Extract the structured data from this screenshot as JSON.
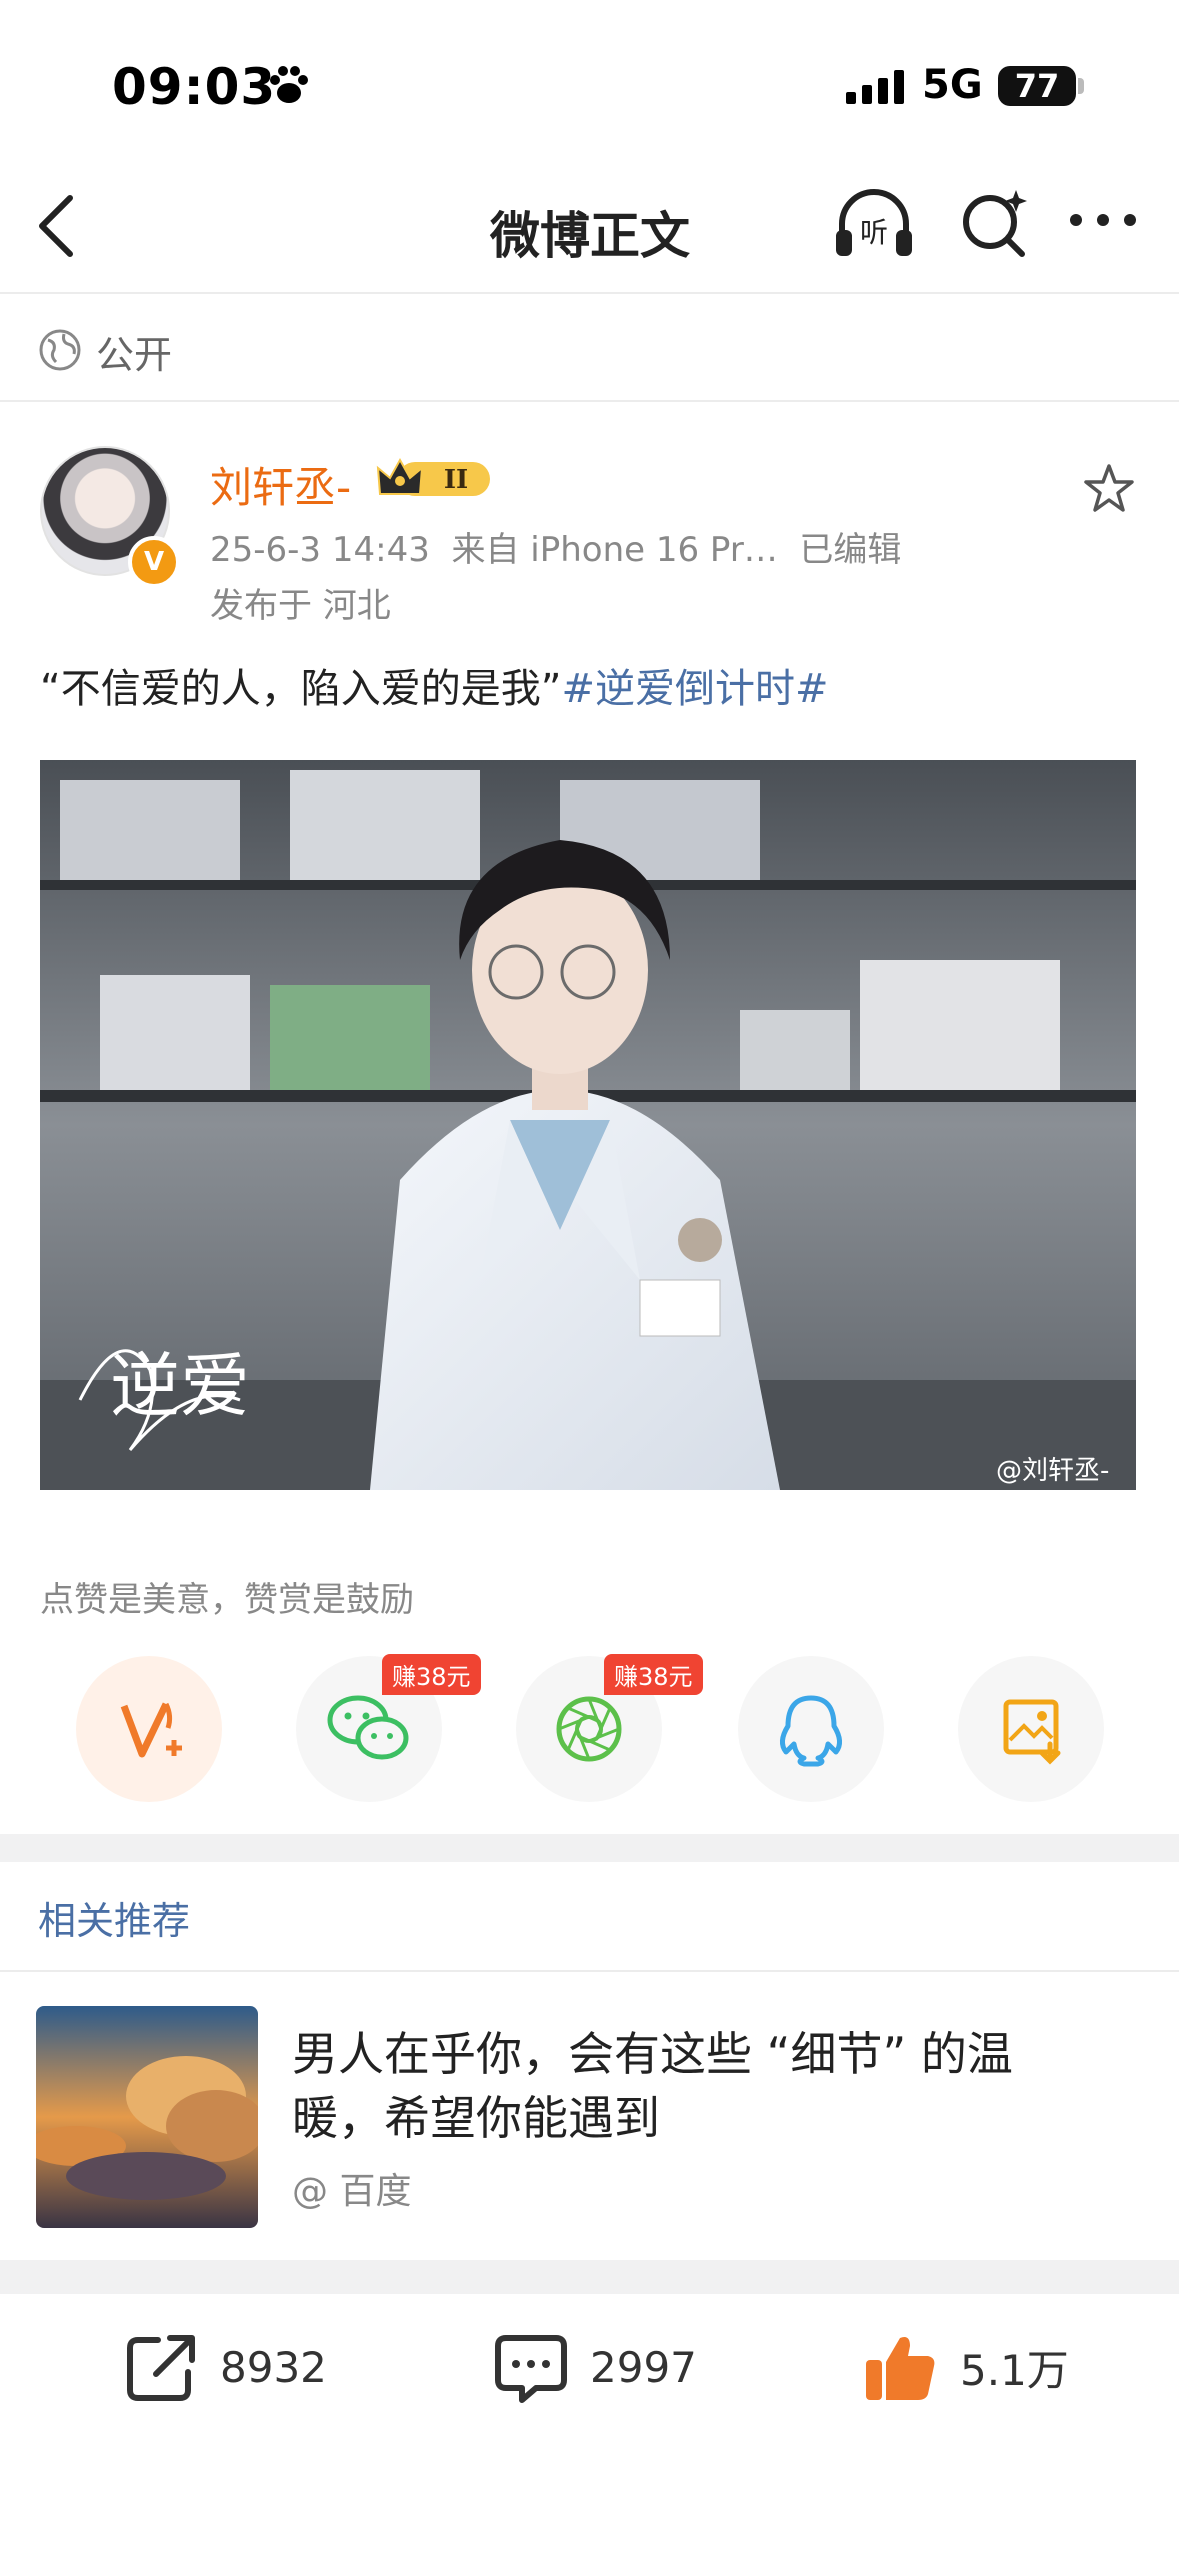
{
  "status_bar": {
    "time": "09:03",
    "network": "5G",
    "battery": "77"
  },
  "nav": {
    "title": "微博正文",
    "listen_label": "听"
  },
  "visibility": "公开",
  "post": {
    "username": "刘轩丞-",
    "vip_level": "II",
    "meta": "25-6-3 14:43  来自 iPhone 16 Pr…  已编辑",
    "location": "发布于 河北",
    "text": "“不信爱的人，陷入爱的是我”",
    "topic": "#逆爱倒计时#",
    "image_watermark": "@刘轩丞-",
    "image_logo": "逆爱"
  },
  "tip": "点赞是美意，赞赏是鼓励",
  "share": {
    "badge_wechat": "赚38元",
    "badge_moments": "赚38元"
  },
  "related": {
    "title": "相关推荐",
    "item_title": "男人在乎你，会有这些 “细节” 的温暖，希望你能遇到",
    "item_source": "@ 百度"
  },
  "actions": {
    "repost": "8932",
    "comment": "2997",
    "like": "5.1万"
  },
  "colors": {
    "accent": "#eb6b12",
    "link": "#4a6fa5",
    "badge": "#f04432",
    "like": "#f07a2a"
  }
}
